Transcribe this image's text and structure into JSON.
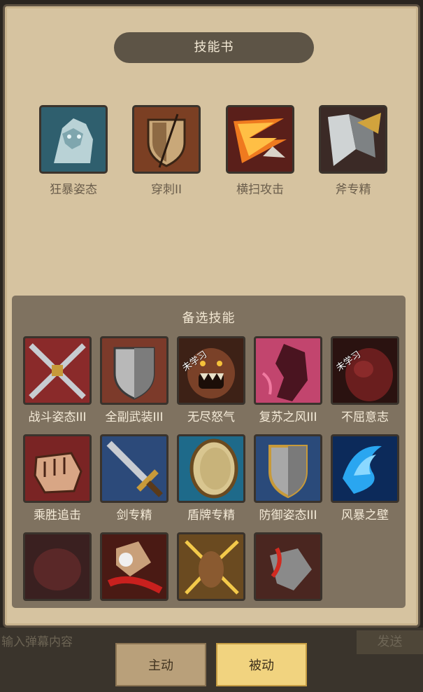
{
  "header": {
    "title": "技能书"
  },
  "learned_skills": [
    {
      "name": "狂暴姿态",
      "icon": "berserk-stance-icon"
    },
    {
      "name": "穿刺II",
      "icon": "pierce-shield-icon"
    },
    {
      "name": "横扫攻击",
      "icon": "sweep-attack-icon"
    },
    {
      "name": "斧专精",
      "icon": "axe-mastery-icon"
    }
  ],
  "alternate": {
    "title": "备选技能",
    "unlearned_label": "未学习",
    "skills": [
      {
        "name": "战斗姿态III",
        "icon": "battle-stance-icon",
        "unlearned": false
      },
      {
        "name": "全副武装III",
        "icon": "full-armor-icon",
        "unlearned": false
      },
      {
        "name": "无尽怒气",
        "icon": "endless-rage-icon",
        "unlearned": true
      },
      {
        "name": "复苏之风III",
        "icon": "revival-wind-icon",
        "unlearned": false
      },
      {
        "name": "不屈意志",
        "icon": "unyielding-will-icon",
        "unlearned": true
      },
      {
        "name": "乘胜追击",
        "icon": "pursuit-fist-icon",
        "unlearned": false
      },
      {
        "name": "剑专精",
        "icon": "sword-mastery-icon",
        "unlearned": false
      },
      {
        "name": "盾牌专精",
        "icon": "shield-mastery-icon",
        "unlearned": false
      },
      {
        "name": "防御姿态III",
        "icon": "defense-stance-icon",
        "unlearned": false
      },
      {
        "name": "风暴之壁",
        "icon": "storm-wall-icon",
        "unlearned": false
      },
      {
        "name": "",
        "icon": "dark-beast-icon",
        "unlearned": false
      },
      {
        "name": "",
        "icon": "blood-strike-icon",
        "unlearned": false
      },
      {
        "name": "",
        "icon": "golden-burst-icon",
        "unlearned": false
      },
      {
        "name": "",
        "icon": "claw-slash-icon",
        "unlearned": false
      }
    ]
  },
  "chat": {
    "placeholder": "输入弹幕内容",
    "send_label": "发送"
  },
  "tabs": {
    "active_label": "主动",
    "passive_label": "被动"
  }
}
